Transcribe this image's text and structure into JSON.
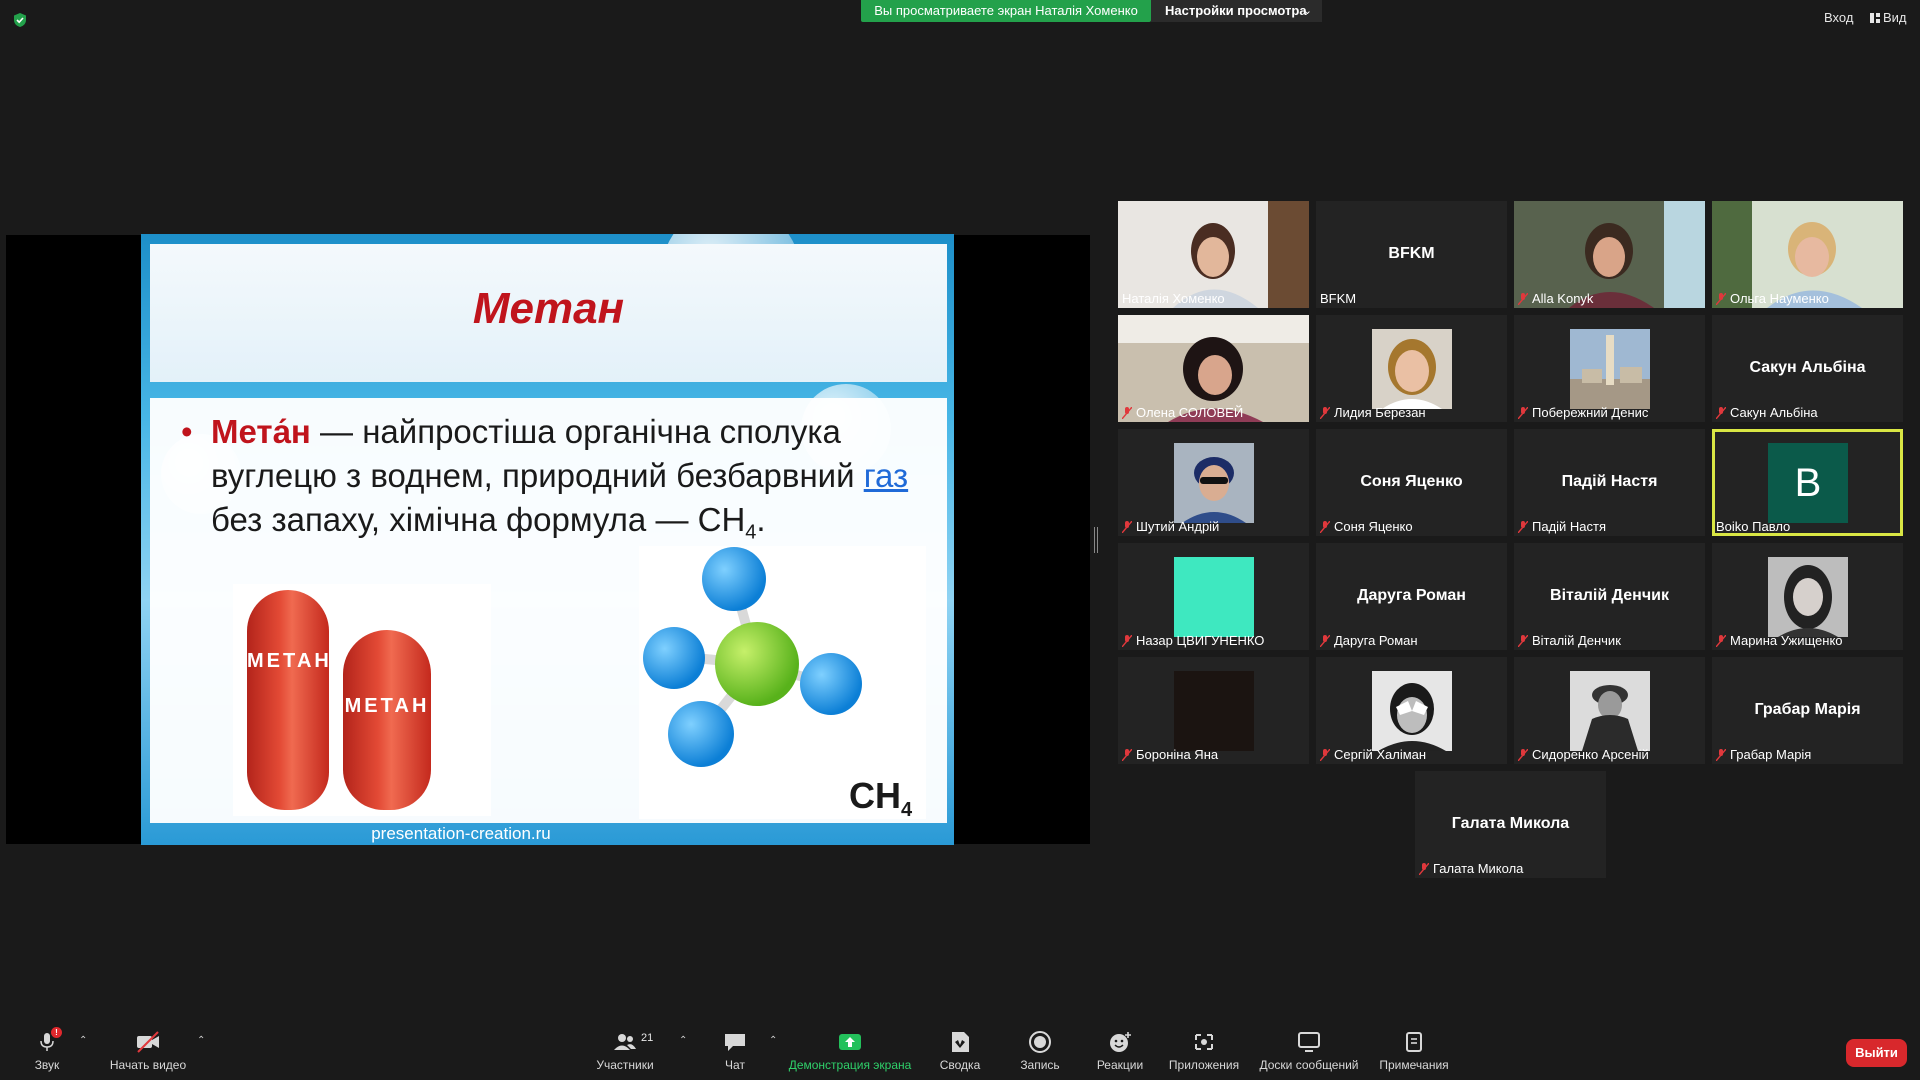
{
  "topbar": {
    "share_banner": "Вы просматриваете экран Наталія Хоменко",
    "view_settings": "Настройки просмотра",
    "enter": "Вход",
    "view": "Вид"
  },
  "slide": {
    "title": "Метан",
    "bullet": "•",
    "term": "Мета́н",
    "text_1": " — найпростіша органічна сполука вуглецю з воднем, природний безбарвний ",
    "link": "газ",
    "text_2": " без запаху, хімічна формула — CH",
    "sub": "4",
    "end": ".",
    "tank_label": "МЕТАН",
    "ch4": "CH",
    "ch4_sub": "4",
    "source": "presentation-creation.ru"
  },
  "participants": [
    {
      "name": "Наталія Хоменко"
    },
    {
      "name": "BFKM",
      "center": "BFKM"
    },
    {
      "name": "Alla Konyk"
    },
    {
      "name": "Ольга Науменко"
    },
    {
      "name": "Олена СОЛОВЕЙ"
    },
    {
      "name": "Лидия Березан"
    },
    {
      "name": "Побережний Денис"
    },
    {
      "name": "Сакун Альбіна",
      "center": "Сакун Альбіна"
    },
    {
      "name": "Шутий Андрій"
    },
    {
      "name": "Соня Яценко",
      "center": "Соня Яценко"
    },
    {
      "name": "Падій Настя",
      "center": "Падій Настя"
    },
    {
      "name": "Boiko Павло",
      "initial": "B"
    },
    {
      "name": "Назар ЦВИГУНЕНКО"
    },
    {
      "name": "Даруга Роман",
      "center": "Даруга Роман"
    },
    {
      "name": "Віталій Денчик",
      "center": "Віталій Денчик"
    },
    {
      "name": "Марина Ужищенко"
    },
    {
      "name": "Бороніна Яна"
    },
    {
      "name": "Сергій Халіман"
    },
    {
      "name": "Сидоренко Арсеній"
    },
    {
      "name": "Грабар Марія",
      "center": "Грабар Марія"
    },
    {
      "name": "Галата Микола",
      "center": "Галата Микола"
    }
  ],
  "toolbar": {
    "audio": "Звук",
    "audio_badge": "!",
    "video": "Начать видео",
    "participants": "Участники",
    "participants_count": "21",
    "chat": "Чат",
    "share": "Демонстрация экрана",
    "summary": "Сводка",
    "record": "Запись",
    "reactions": "Реакции",
    "apps": "Приложения",
    "whiteboards": "Доски сообщений",
    "notes": "Примечания",
    "leave": "Выйти"
  },
  "colors": {
    "share_green": "#23a14b",
    "active_speaker": "#d9e644",
    "leave_red": "#d8282c",
    "title_red": "#c0141c"
  }
}
